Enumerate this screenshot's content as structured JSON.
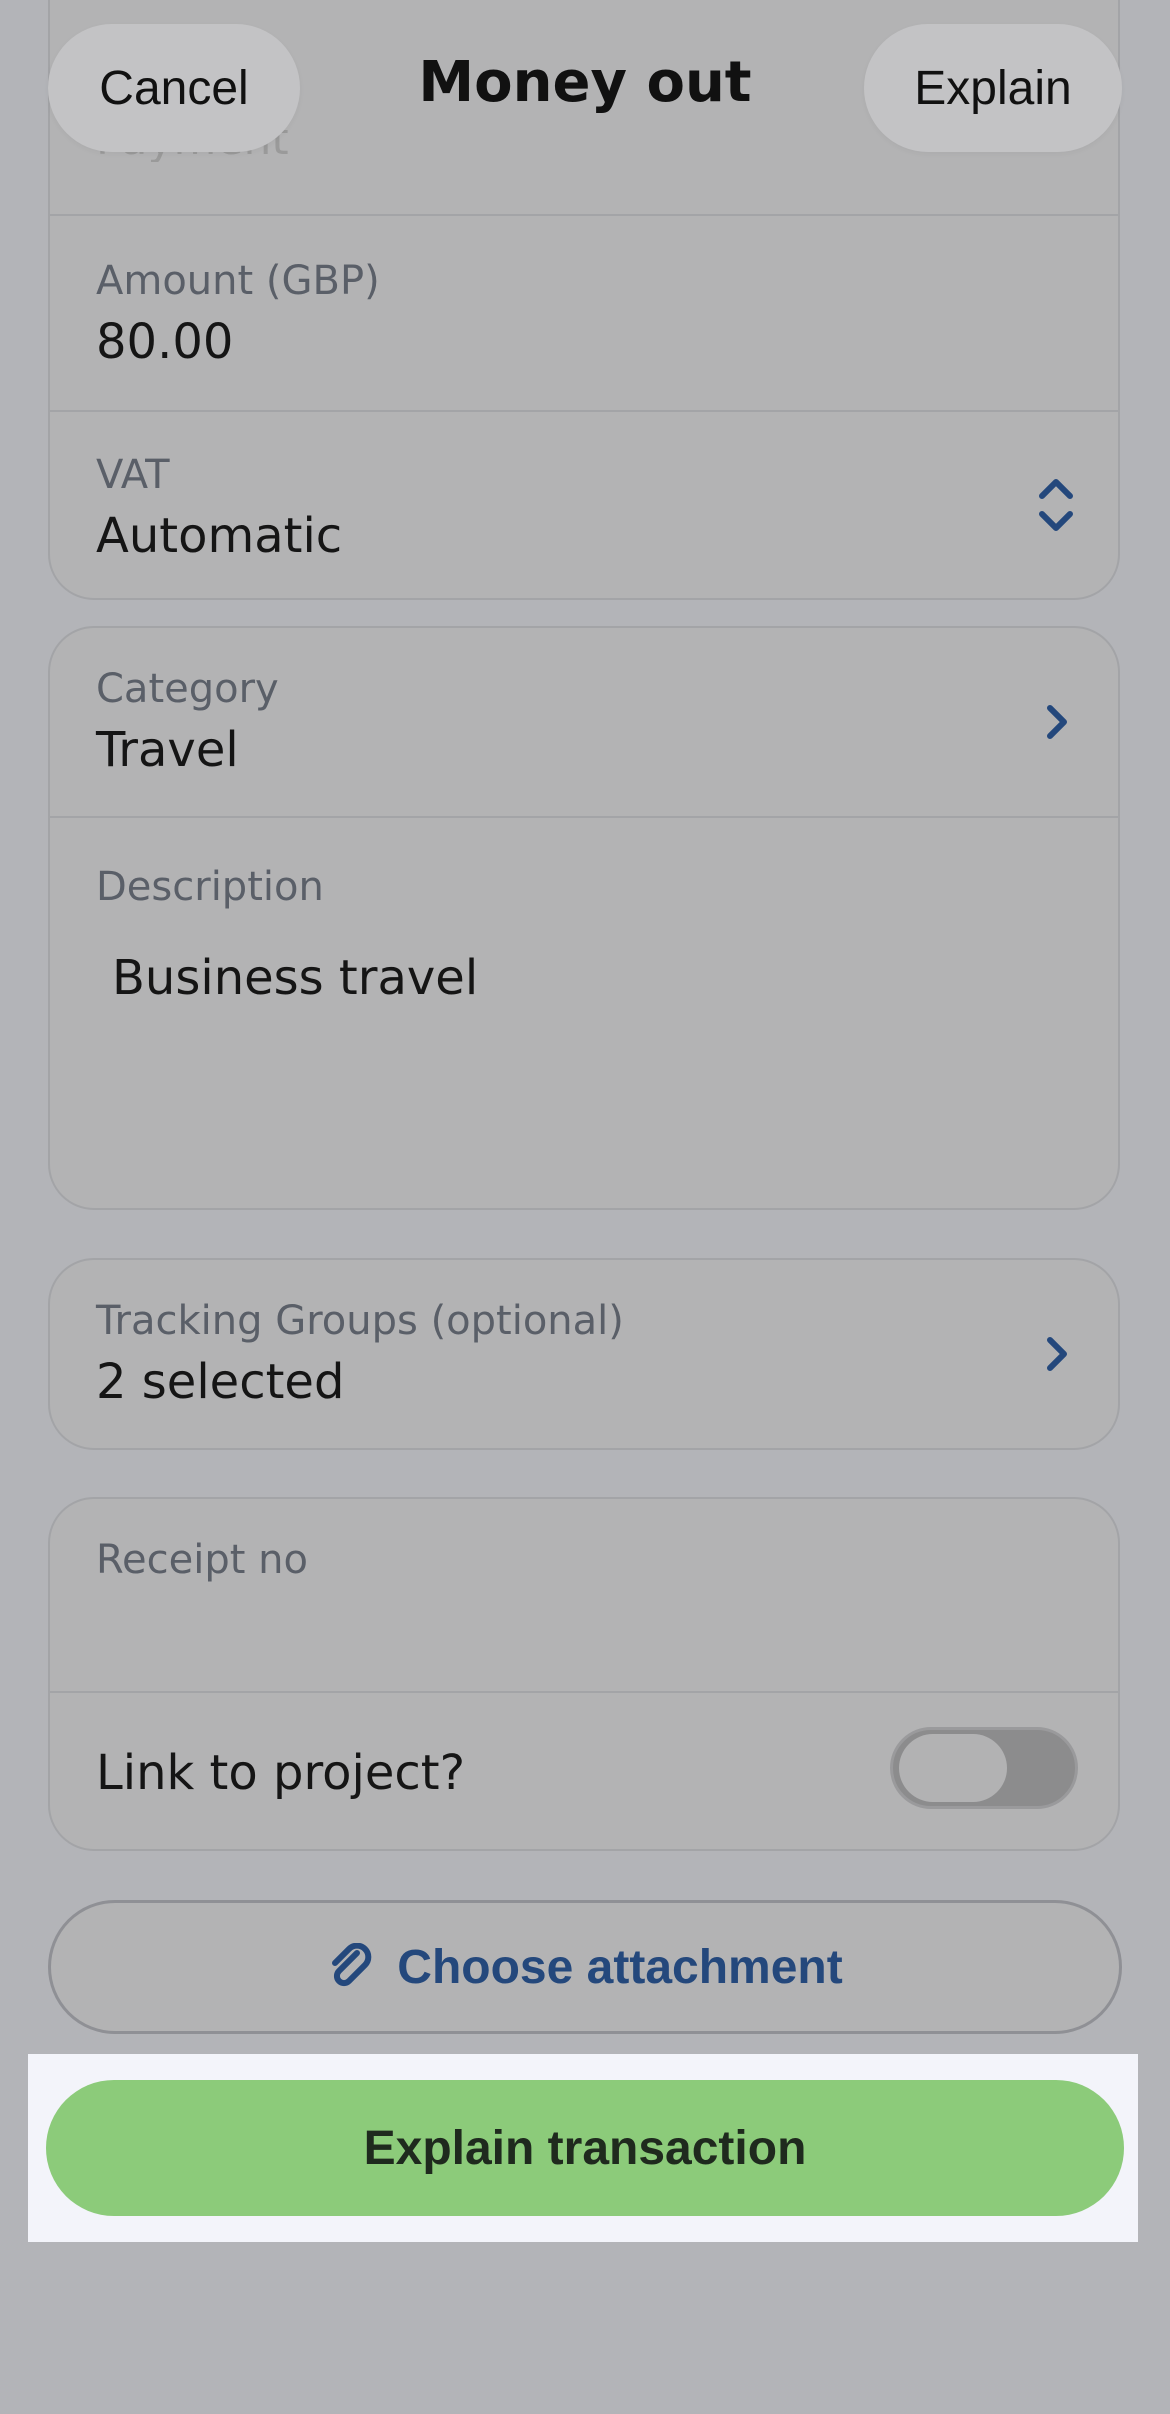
{
  "header": {
    "cancel_label": "Cancel",
    "title": "Money out",
    "explain_label": "Explain"
  },
  "top_group": {
    "partial_value": "Payment",
    "amount_label": "Amount (GBP)",
    "amount_value": "80.00",
    "vat_label": "VAT",
    "vat_value": "Automatic"
  },
  "category_group": {
    "category_label": "Category",
    "category_value": "Travel",
    "description_label": "Description",
    "description_value": "Business travel"
  },
  "tracking": {
    "label": "Tracking Groups (optional)",
    "value": "2 selected"
  },
  "receipt_group": {
    "receipt_label": "Receipt no",
    "receipt_value": "",
    "link_project_label": "Link to project?",
    "link_project_on": false
  },
  "attachment": {
    "label": "Choose attachment",
    "icon": "paperclip-icon"
  },
  "primary": {
    "label": "Explain transaction"
  },
  "colors": {
    "accent_blue": "#24487c",
    "primary_green": "#8ccb7a",
    "overlay_gray": "#b3b4b8"
  }
}
